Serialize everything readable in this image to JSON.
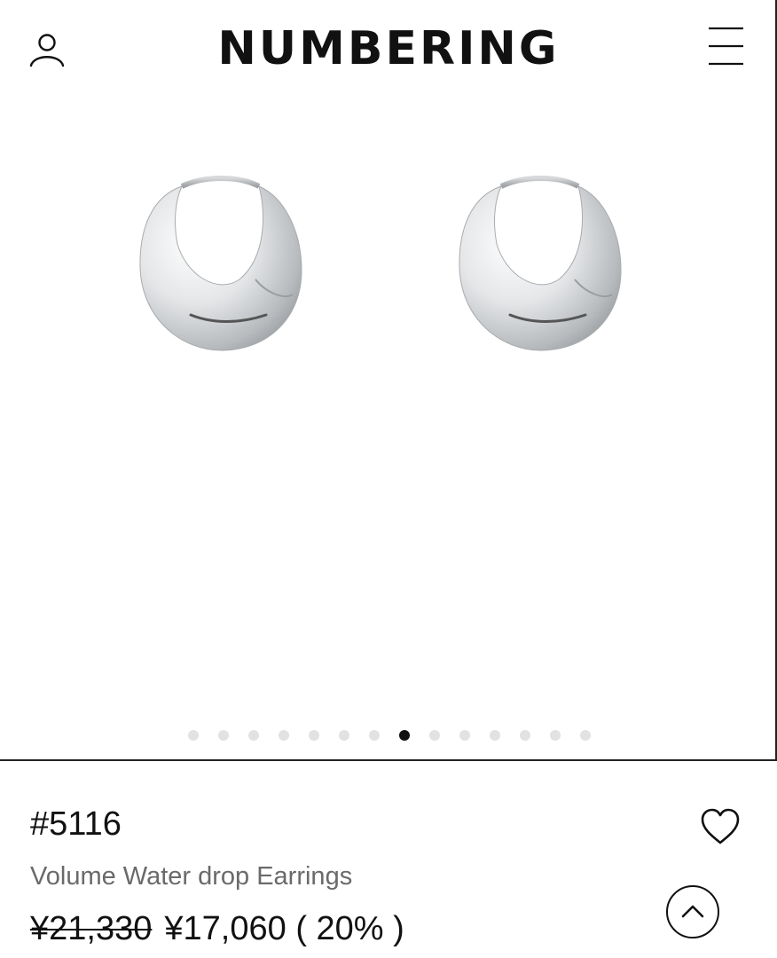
{
  "header": {
    "brand": "NUMBERING",
    "account_icon": "user-outline-icon",
    "menu_icon": "hamburger-menu-icon"
  },
  "gallery": {
    "image_subject": "silver hoop earrings",
    "slide_count": 14,
    "active_slide": 8
  },
  "product": {
    "code": "#5116",
    "name": "Volume Water drop Earrings",
    "original_price": "¥21,330",
    "sale_price": "¥17,060",
    "discount": "( 20% )",
    "wishlist_icon": "heart-outline-icon",
    "scroll_top_icon": "chevron-up-icon"
  },
  "colors": {
    "text": "#111111",
    "muted_text": "#6a6a6a",
    "inactive_dot": "#e2e2e2",
    "background": "#ffffff"
  }
}
